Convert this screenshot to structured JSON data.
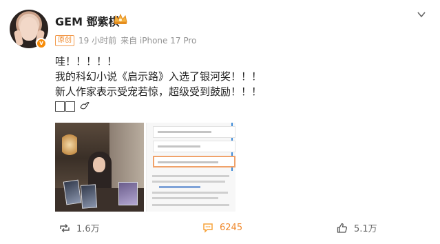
{
  "post": {
    "username": "GEM 鄧紫棋",
    "tag": "原创",
    "time": "19 小时前",
    "source": "来自 iPhone 17 Pro",
    "lines": [
      "哇！！！！！",
      "我的科幻小说《启示路》入选了银河奖！！！",
      "新人作家表示受宠若惊，超级受到鼓励！！！"
    ]
  },
  "actions": {
    "repost_count": "1.6万",
    "comment_count": "6245",
    "like_count": "5.1万"
  },
  "colors": {
    "accent_orange": "#f08a2e",
    "comment_icon": "#f7a239",
    "text": "#1f1f1f",
    "meta": "#939393"
  }
}
